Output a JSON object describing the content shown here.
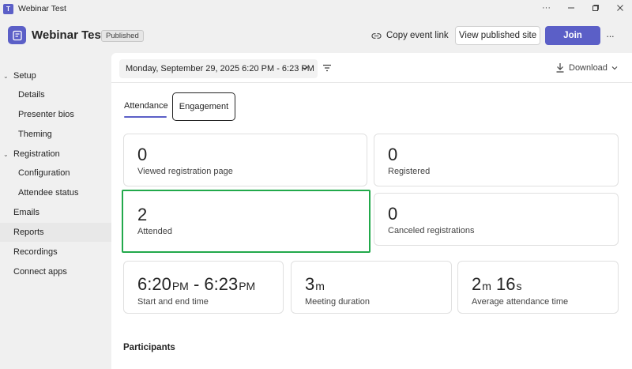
{
  "window": {
    "title": "Webinar Test",
    "app_icon": "teams-icon"
  },
  "header": {
    "event_title": "Webinar Test",
    "status_badge": "Published",
    "copy_link_label": "Copy event link",
    "view_site_label": "View published site",
    "join_label": "Join",
    "accent_color": "#5b5fc7"
  },
  "sidebar": {
    "items": [
      {
        "label": "Setup",
        "type": "group",
        "expanded": true
      },
      {
        "label": "Details",
        "type": "child"
      },
      {
        "label": "Presenter bios",
        "type": "child"
      },
      {
        "label": "Theming",
        "type": "child"
      },
      {
        "label": "Registration",
        "type": "group",
        "expanded": true
      },
      {
        "label": "Configuration",
        "type": "child"
      },
      {
        "label": "Attendee status",
        "type": "child"
      },
      {
        "label": "Emails",
        "type": "item"
      },
      {
        "label": "Reports",
        "type": "item",
        "selected": true
      },
      {
        "label": "Recordings",
        "type": "item"
      },
      {
        "label": "Connect apps",
        "type": "item"
      }
    ]
  },
  "toolbar": {
    "date_range": "Monday, September 29, 2025 6:20 PM - 6:23 PM",
    "download_label": "Download"
  },
  "tabs": [
    {
      "label": "Attendance",
      "active": true
    },
    {
      "label": "Engagement",
      "active": false
    }
  ],
  "stats": {
    "viewed_registration": {
      "value": "0",
      "label": "Viewed registration page"
    },
    "registered": {
      "value": "0",
      "label": "Registered"
    },
    "attended": {
      "value": "2",
      "label": "Attended",
      "highlight_color": "#22a94b"
    },
    "canceled": {
      "value": "0",
      "label": "Canceled registrations"
    },
    "time_range": {
      "start": "6:20",
      "start_ampm": "PM",
      "separator": " - ",
      "end": "6:23",
      "end_ampm": "PM",
      "label": "Start and end time"
    },
    "duration": {
      "value": "3",
      "unit": "m",
      "label": "Meeting duration"
    },
    "avg_attendance": {
      "minutes": "2",
      "minutes_unit": "m",
      "seconds": "16",
      "seconds_unit": "s",
      "label": "Average attendance time"
    }
  },
  "participants_heading": "Participants"
}
